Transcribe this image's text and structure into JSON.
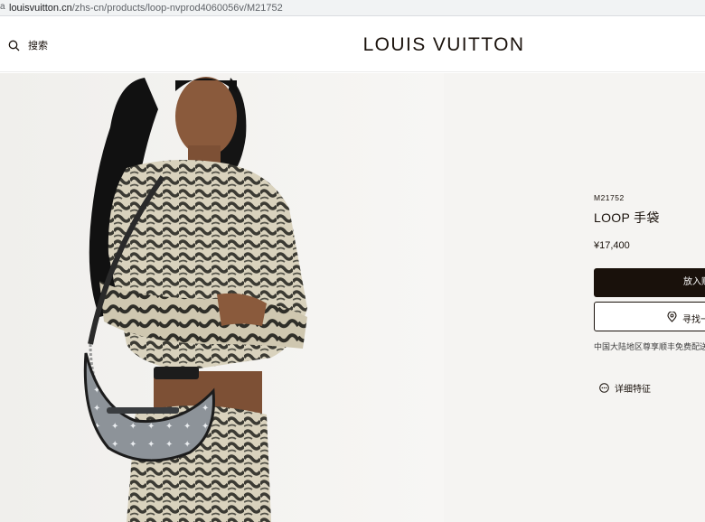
{
  "browser": {
    "url_host": "louisvuitton.cn",
    "url_path": "/zhs-cn/products/loop-nvprod4060056v/M21752"
  },
  "header": {
    "search_label": "搜索",
    "logo": "LOUIS VUITTON"
  },
  "product": {
    "sku": "M21752",
    "name": "LOOP 手袋",
    "price": "¥17,400",
    "add_to_cart_label": "放入购物车",
    "find_in_store_label": "寻找一",
    "delivery_note": "中国大陆地区尊享顺丰免费配送",
    "details_label": "详细特征"
  },
  "colors": {
    "brand_dark": "#19110b",
    "panel_bg": "#f5f4f2",
    "photo_bg": "#f4f3f1"
  },
  "icons": {
    "search": "search-icon",
    "location": "location-pin-icon",
    "details": "more-dots-icon"
  }
}
